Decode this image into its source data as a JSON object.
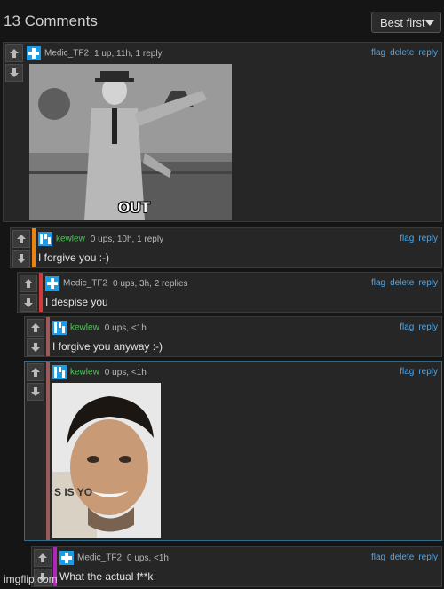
{
  "header": {
    "title": "13 Comments",
    "sort_label": "Best first"
  },
  "comments": [
    {
      "user": "Medic_TF2",
      "stats": "1 up, 11h, 1 reply",
      "actions": [
        "flag",
        "delete",
        "reply"
      ],
      "text": "",
      "image_caption": "OUT",
      "bar_color": ""
    },
    {
      "user": "kewlew",
      "stats": "0 ups, 10h, 1 reply",
      "actions": [
        "flag",
        "reply"
      ],
      "text": "I forgive you :-)",
      "bar_color": "#e8840f"
    },
    {
      "user": "Medic_TF2",
      "stats": "0 ups, 3h, 2 replies",
      "actions": [
        "flag",
        "delete",
        "reply"
      ],
      "text": "I despise you",
      "bar_color": "#d23a3a"
    },
    {
      "user": "kewlew",
      "stats": "0 ups, <1h",
      "actions": [
        "flag",
        "reply"
      ],
      "text": "I forgive you anyway :-)",
      "bar_color": "#9a5a5a"
    },
    {
      "user": "kewlew",
      "stats": "0 ups, <1h",
      "actions": [
        "flag",
        "reply"
      ],
      "text": "",
      "image_text": "S IS YO",
      "bar_color": "#9a5a5a"
    },
    {
      "user": "Medic_TF2",
      "stats": "0 ups, <1h",
      "actions": [
        "flag",
        "delete",
        "reply"
      ],
      "text": "What the actual f**k",
      "bar_color": "#b026b8"
    }
  ],
  "watermark": "imgflip.com",
  "colors": {
    "link": "#4ea6e8",
    "medic_avatar": "#1c9be6",
    "kewlew_avatar": "#1c9be6"
  }
}
